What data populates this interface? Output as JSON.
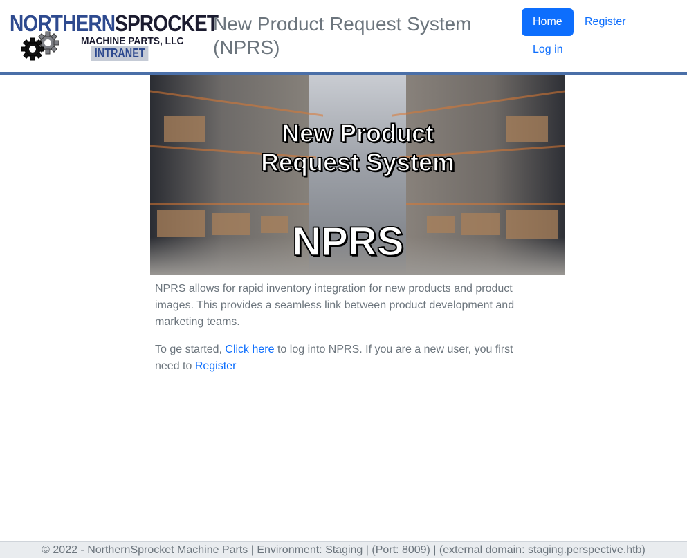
{
  "logo": {
    "brand_part1": "NORTHERN",
    "brand_part2": "SPROCKET",
    "subtitle": "MACHINE PARTS, LLC",
    "tagline": "INTRANET",
    "icons": [
      "gear-icon",
      "gear-icon"
    ]
  },
  "header": {
    "title": "New Product Request System (NPRS)"
  },
  "nav": {
    "home": "Home",
    "register": "Register",
    "login": "Log in",
    "active_color": "#0d6efd"
  },
  "hero": {
    "line1": "New Product",
    "line2": "Request System",
    "acronym": "NPRS"
  },
  "content": {
    "intro": "NPRS allows for rapid inventory integration for new products and product images. This provides a seamless link between product development and marketing teams.",
    "start_prefix": "To ge started, ",
    "click_here": "Click here",
    "start_middle": " to log into NPRS. If you are a new user, you first need to ",
    "register_link": "Register"
  },
  "footer": {
    "text": "© 2022 - NorthernSprocket Machine Parts | Environment: Staging | (Port: 8009) | (external domain: staging.perspective.htb)"
  },
  "colors": {
    "header_border": "#4a6fa8",
    "link": "#0d6efd",
    "text": "#6c757d",
    "footer_bg": "#e9ecef"
  }
}
